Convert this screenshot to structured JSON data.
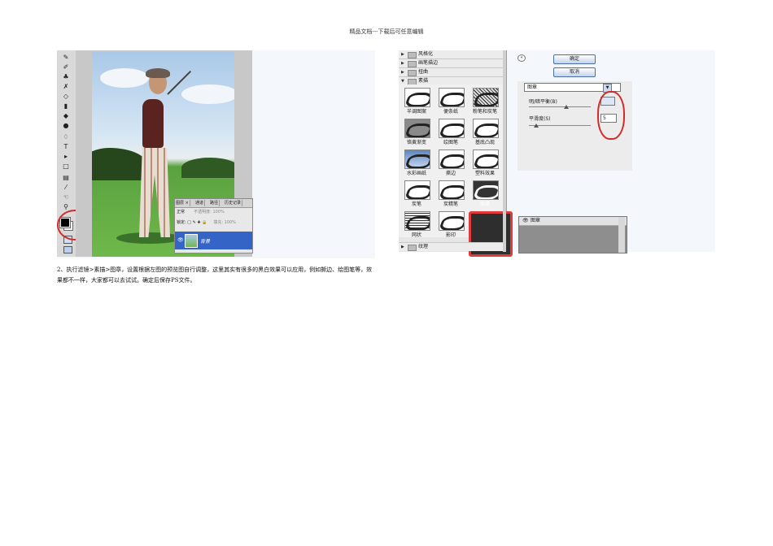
{
  "header": {
    "text": "精品文档---下载后可任意编辑"
  },
  "left_figure": {
    "layers_panel": {
      "tabs": [
        "图层 ×",
        "通道",
        "路径",
        "历史记录"
      ],
      "blend_mode": "正常",
      "opacity_label": "不透明度:",
      "opacity_value": "100%",
      "lock_label": "锁定:",
      "fill_label": "填充:",
      "fill_value": "100%",
      "layer_name": "背景"
    }
  },
  "right_figure": {
    "categories": [
      "风格化",
      "画笔描边",
      "扭曲",
      "素描"
    ],
    "thumbnails": [
      {
        "label": "半调图案",
        "style": "plain"
      },
      {
        "label": "便条纸",
        "style": "plain"
      },
      {
        "label": "粉笔和炭笔",
        "style": "noise"
      },
      {
        "label": "铬黄渐变",
        "style": "gray"
      },
      {
        "label": "绘图笔",
        "style": "plain"
      },
      {
        "label": "基底凸现",
        "style": "plain"
      },
      {
        "label": "水彩画纸",
        "style": "blue"
      },
      {
        "label": "撕边",
        "style": "plain"
      },
      {
        "label": "塑料效果",
        "style": "plain"
      },
      {
        "label": "炭笔",
        "style": "plain"
      },
      {
        "label": "炭精笔",
        "style": "plain"
      },
      {
        "label": "图章",
        "style": "dark"
      },
      {
        "label": "网状",
        "style": "rough"
      },
      {
        "label": "影印",
        "style": "plain"
      }
    ],
    "bottom_category": "纹理",
    "ok_button": "确定",
    "cancel_button": "取消",
    "filter_select": "图章",
    "param1_label": "明/暗平衡(B)",
    "param1_value": "",
    "param2_label": "平滑度(S)",
    "param2_value": "5",
    "preview_layer": "图章"
  },
  "caption": {
    "text": "2、执行滤镜>素描>图章，设置根据左图的预览图自行调整，这里其实有很多的黑白效果可以应用，例如撕边、绘图笔等，效果都不一样，大家都可以去试试。确定后保存PS文件。"
  }
}
